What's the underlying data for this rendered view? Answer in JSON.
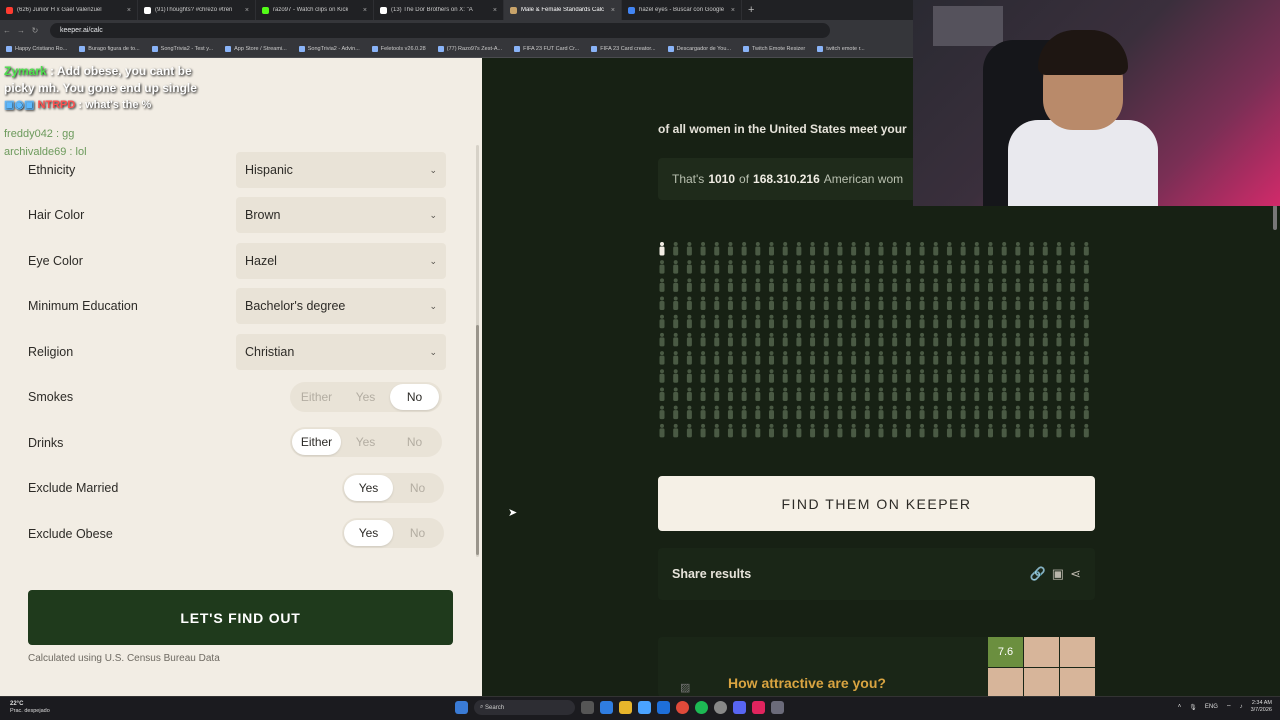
{
  "browser": {
    "tabs": [
      {
        "label": "(626) Junior H x Gael Valenzuel",
        "color": "#ff3b30"
      },
      {
        "label": "(91)Thoughts? #chrezo #tren",
        "color": "#ffffff"
      },
      {
        "label": "razo97 - Watch clips on Kick",
        "color": "#53fc18"
      },
      {
        "label": "(13) The Dor Brothers on X: \"A",
        "color": "#ffffff"
      },
      {
        "label": "Male & Female Standards Calc",
        "color": "#c9a46a",
        "active": true
      },
      {
        "label": "hazel eyes - Buscar con Google",
        "color": "#4285f4"
      }
    ],
    "url": "keeper.ai/calc",
    "bookmarks": [
      "Happy Cristiano Ro...",
      "Burago figura de to...",
      "SongTrivia2 - Test y...",
      "App Store / Streami...",
      "SongTrivia2 - Advin...",
      "Feletools v26.0.28",
      "(77) Razo97s Zest-A...",
      "FIFA 23 FUT Card Cr...",
      "FIFA 23 Card creator...",
      "Descargador de You...",
      "Twitch Emote Resizer",
      "twitch emote r..."
    ]
  },
  "chat": {
    "user1": "Zymark",
    "msg1_a": " : Add obese, you cant be",
    "msg1_b": "picky mh. You gone end up single",
    "user2": "NTRPD",
    "msg2": " : what's the %",
    "line3": "freddy042 : gg",
    "line4": "archivalde69 : lol"
  },
  "form": {
    "ethnicity": {
      "label": "Ethnicity",
      "value": "Hispanic"
    },
    "hair": {
      "label": "Hair Color",
      "value": "Brown"
    },
    "eye": {
      "label": "Eye Color",
      "value": "Hazel"
    },
    "education": {
      "label": "Minimum Education",
      "value": "Bachelor's degree"
    },
    "religion": {
      "label": "Religion",
      "value": "Christian"
    },
    "smokes": {
      "label": "Smokes",
      "options": [
        "Either",
        "Yes",
        "No"
      ],
      "selected": "No"
    },
    "drinks": {
      "label": "Drinks",
      "options": [
        "Either",
        "Yes",
        "No"
      ],
      "selected": "Either"
    },
    "married": {
      "label": "Exclude Married",
      "options": [
        "Yes",
        "No"
      ],
      "selected": "Yes"
    },
    "obese": {
      "label": "Exclude Obese",
      "options": [
        "Yes",
        "No"
      ],
      "selected": "Yes"
    },
    "cta": "LET'S FIND OUT",
    "note": "Calculated using U.S. Census Bureau Data"
  },
  "results": {
    "heading": "of all women in the United States meet your",
    "stat_prefix": "That's",
    "count": "1010",
    "stat_of": "of",
    "total": "168.310.216",
    "stat_suffix": "American wom",
    "find_button": "FIND THEM ON KEEPER",
    "share_label": "Share results",
    "attr_title": "How attractive are you?",
    "attr_score": "7.6",
    "highlighted_figures": 1,
    "figure_rows": 11,
    "figure_cols": 32
  },
  "taskbar": {
    "weather_temp": "22°C",
    "weather_desc": "Prac. despejado",
    "search": "Search",
    "lang": "ENG",
    "time": "2:34 AM",
    "date": "3/7/2026"
  },
  "colors": {
    "page_bg": "#172114",
    "panel_bg": "#f2ede4",
    "cta_bg": "#1f3a1c",
    "figure": "#4a5a44",
    "figure_highlight": "#f2ede4",
    "attr_title": "#d9a441"
  }
}
